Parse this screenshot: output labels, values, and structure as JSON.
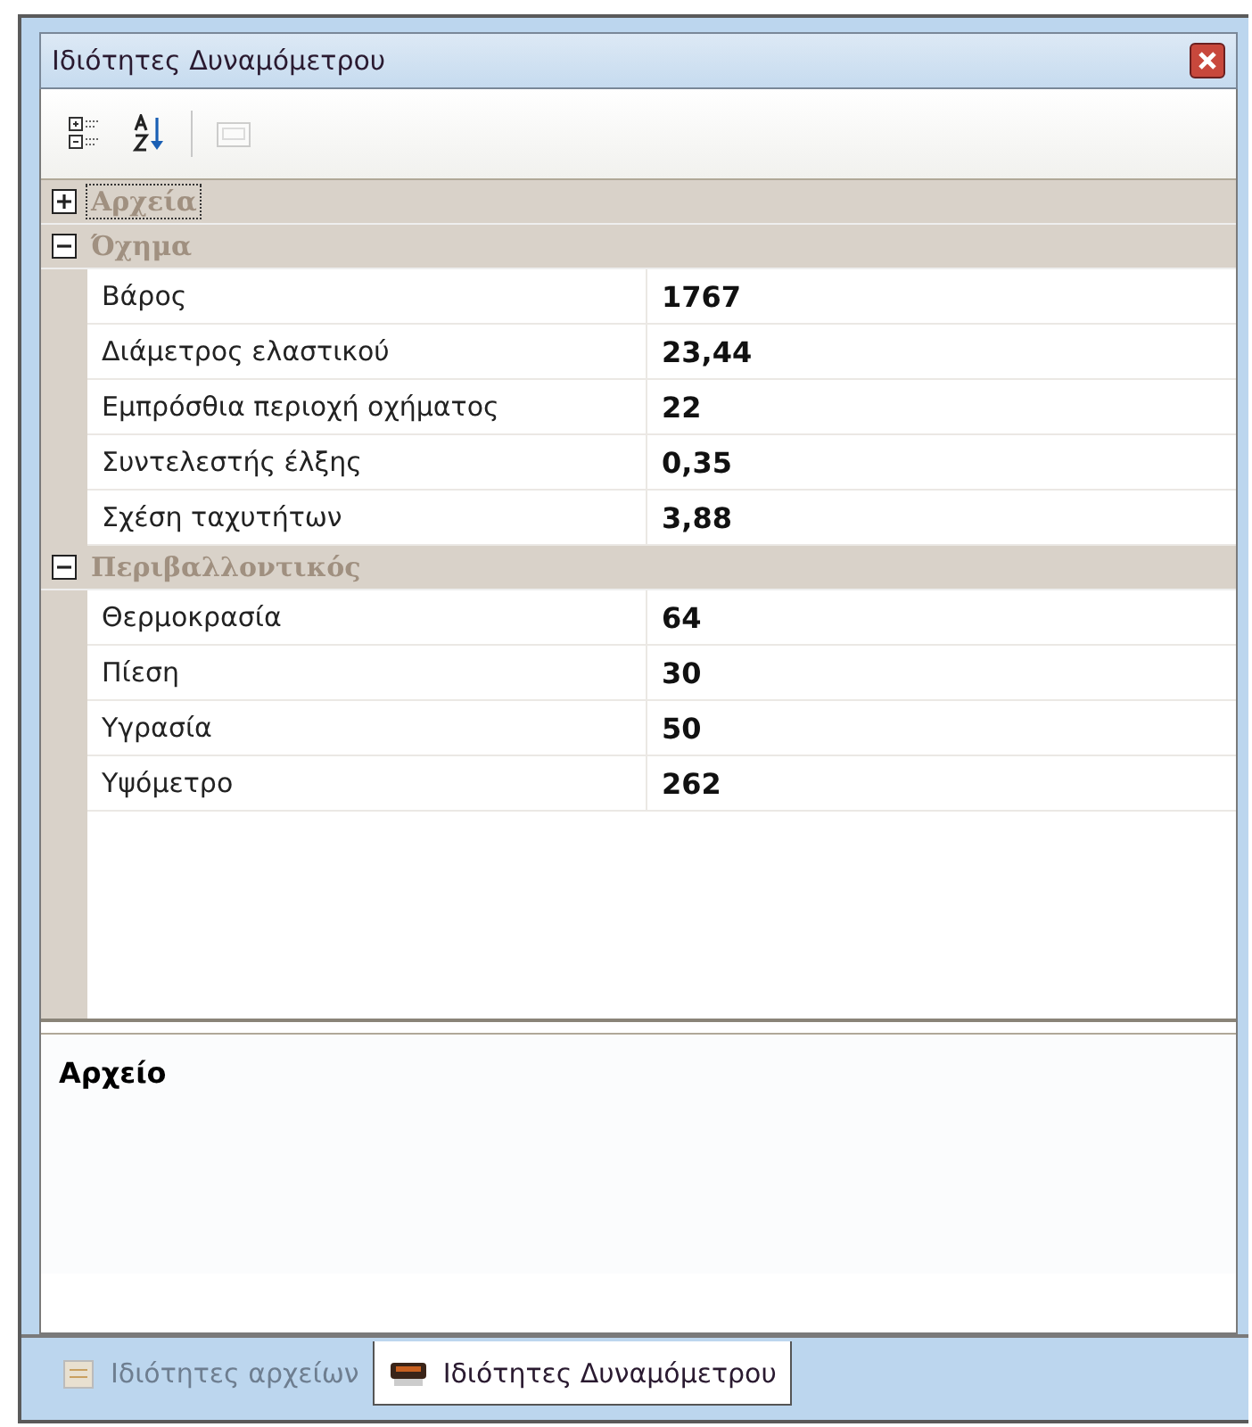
{
  "window": {
    "title": "Ιδιότητες Δυναμόμετρου"
  },
  "toolbar": [
    {
      "kind": "categorized",
      "disabled": false
    },
    {
      "kind": "alphabetical",
      "disabled": false
    },
    {
      "kind": "pages",
      "disabled": true
    }
  ],
  "categories": [
    {
      "name": "Αρχεία",
      "expanded": false,
      "selected": true
    },
    {
      "name": "Όχημα",
      "expanded": true,
      "selected": false,
      "rows": [
        {
          "name": "Βάρος",
          "value": "1767"
        },
        {
          "name": "Διάμετρος ελαστικού",
          "value": "23,44"
        },
        {
          "name": "Εμπρόσθια περιοχή οχήματος",
          "value": "22"
        },
        {
          "name": "Συντελεστής έλξης",
          "value": "0,35"
        },
        {
          "name": "Σχέση ταχυτήτων",
          "value": "3,88"
        }
      ]
    },
    {
      "name": "Περιβαλλοντικός",
      "expanded": true,
      "selected": false,
      "rows": [
        {
          "name": "Θερμοκρασία",
          "value": "64"
        },
        {
          "name": "Πίεση",
          "value": "30"
        },
        {
          "name": "Υγρασία",
          "value": "50"
        },
        {
          "name": "Υψόμετρο",
          "value": "262"
        }
      ]
    }
  ],
  "description": {
    "title": "Αρχείο"
  },
  "tabs": [
    {
      "label": "Ιδιότητες αρχείων",
      "selected": false
    },
    {
      "label": "Ιδιότητες Δυναμόμετρου",
      "selected": true
    }
  ]
}
